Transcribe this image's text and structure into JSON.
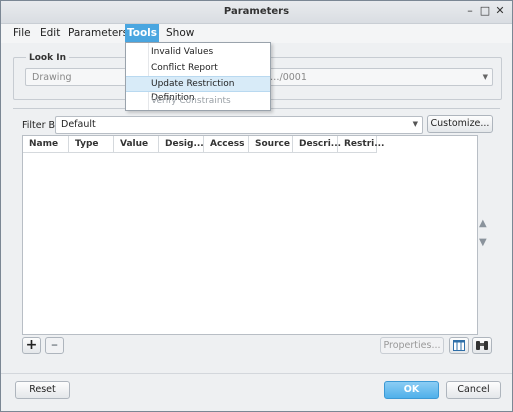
{
  "window": {
    "title": "Parameters"
  },
  "window_controls": {
    "minimize": "–",
    "maximize": "□",
    "close": "✕"
  },
  "menubar": {
    "items": [
      "File",
      "Edit",
      "Parameters",
      "Tools",
      "Show"
    ],
    "active": "Tools"
  },
  "tools_menu": {
    "items": [
      {
        "label": "Invalid Values",
        "state": "normal"
      },
      {
        "label": "Conflict Report",
        "state": "normal"
      },
      {
        "label": "Update Restriction Definition",
        "state": "hover"
      },
      {
        "label": "Verify Constraints",
        "state": "disabled"
      }
    ]
  },
  "look_in": {
    "label": "Look In",
    "type_value": "Drawing",
    "object_value": "…/0001"
  },
  "filter": {
    "label": "Filter By",
    "value": "Default",
    "customize_label": "Customize..."
  },
  "table": {
    "columns": [
      "Name",
      "Type",
      "Value",
      "Desig...",
      "Access",
      "Source",
      "Descri...",
      "Restri..."
    ],
    "rows": []
  },
  "table_actions": {
    "add_icon": "plus-icon",
    "remove_icon": "minus-icon",
    "properties_label": "Properties...",
    "move_up_icon": "arrow-up-icon",
    "move_down_icon": "arrow-down-icon"
  },
  "footer": {
    "reset_label": "Reset",
    "ok_label": "OK",
    "cancel_label": "Cancel"
  },
  "colors": {
    "accent": "#4aa6e0",
    "hover": "#d8ebf8",
    "ok_button": "#4fb0ea"
  }
}
